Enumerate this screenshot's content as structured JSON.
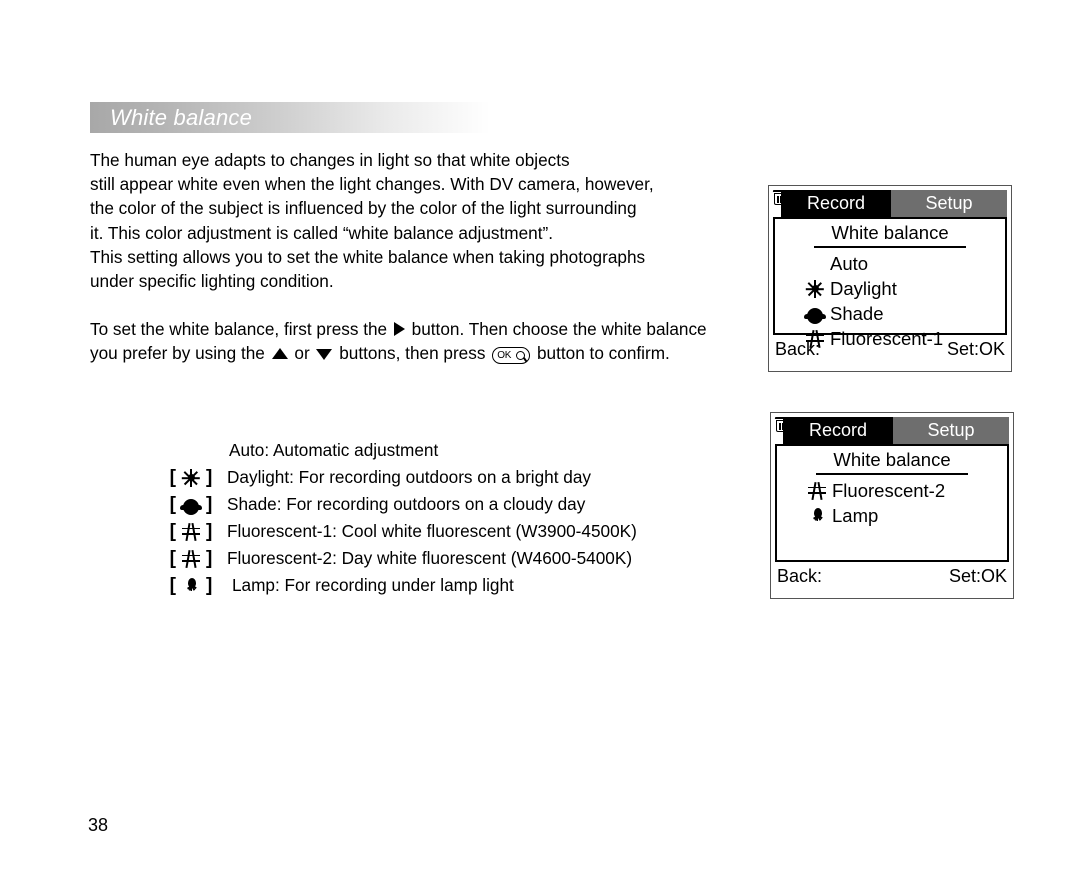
{
  "page": {
    "number": "38"
  },
  "section": {
    "title": "White balance"
  },
  "body": {
    "intro": "The human eye adapts to changes in light so that white objects\nstill appear white even when the light changes. With DV camera, however,\nthe color of the subject is influenced by the color of the light surrounding\nit. This color adjustment is called “white balance adjustment”.\nThis setting allows you to set the white balance when taking photographs\nunder specific lighting condition.",
    "howto": {
      "part1": "To set the white balance, first press the ",
      "part2": " button. Then choose the white balance",
      "part3": "you prefer by using the ",
      "part4": " or ",
      "part5": " buttons, then press ",
      "part6": " button to confirm.",
      "ok_button_label": "OK"
    }
  },
  "legend": {
    "rows": [
      {
        "icon": "none",
        "text": "Auto: Automatic adjustment"
      },
      {
        "icon": "sun-icon",
        "text": "Daylight: For recording outdoors on a bright day"
      },
      {
        "icon": "cloud-icon",
        "text": "Shade: For recording outdoors on a cloudy day"
      },
      {
        "icon": "fluorescent-icon",
        "text": "Fluorescent-1: Cool white fluorescent (W3900-4500K)"
      },
      {
        "icon": "fluorescent-icon",
        "text": "Fluorescent-2: Day white fluorescent (W4600-5400K)"
      },
      {
        "icon": "lamp-icon",
        "text": "Lamp: For recording under lamp light"
      }
    ],
    "bracket_open": "[",
    "bracket_close": "]"
  },
  "lcd_screens": [
    {
      "tabs": {
        "record": "Record",
        "setup": "Setup"
      },
      "title": "White balance",
      "items": [
        {
          "icon": "none",
          "label": "Auto"
        },
        {
          "icon": "sun-icon",
          "label": "Daylight"
        },
        {
          "icon": "cloud-icon",
          "label": "Shade"
        },
        {
          "icon": "fluorescent-icon",
          "label": "Fluorescent-1"
        }
      ],
      "footer": {
        "back_label": "Back:",
        "back_icon": "trash-icon",
        "set_label": "Set:OK"
      }
    },
    {
      "tabs": {
        "record": "Record",
        "setup": "Setup"
      },
      "title": "White balance",
      "items": [
        {
          "icon": "fluorescent-icon",
          "label": "Fluorescent-2"
        },
        {
          "icon": "lamp-icon",
          "label": "Lamp"
        }
      ],
      "footer": {
        "back_label": "Back:",
        "back_icon": "trash-icon",
        "set_label": "Set:OK"
      }
    }
  ],
  "colors": {
    "tab_active_bg": "#000000",
    "tab_inactive_bg": "#6e6e6e",
    "header_gradient_start": "#a8a8a8",
    "header_gradient_end": "#ffffff",
    "lcd_frame": "#555555"
  }
}
